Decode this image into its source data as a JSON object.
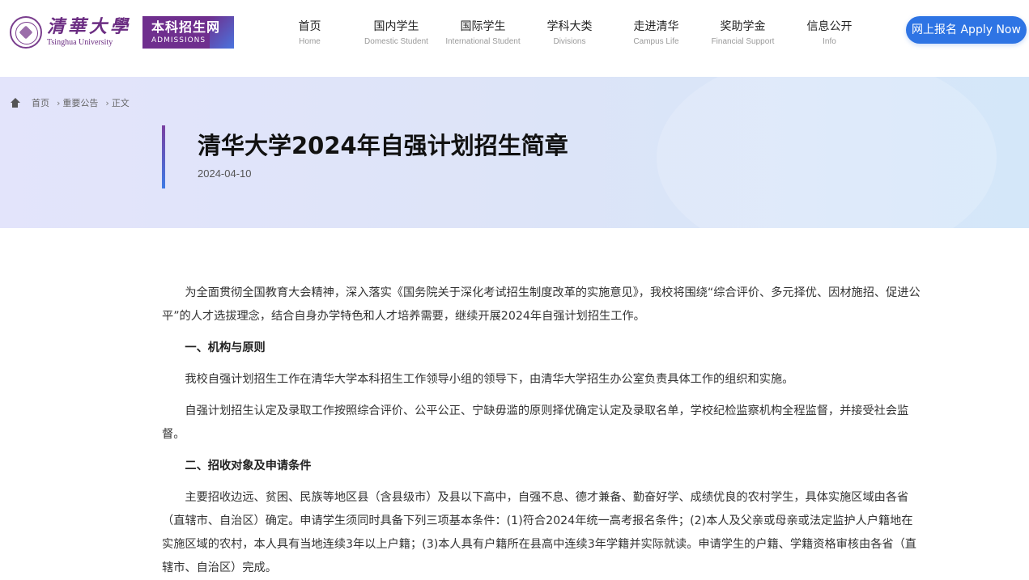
{
  "header": {
    "logo_cn": "清華大學",
    "logo_en": "Tsinghua University",
    "badge_cn": "本科招生网",
    "badge_en": "ADMISSIONS",
    "nav": [
      {
        "cn": "首页",
        "en": "Home"
      },
      {
        "cn": "国内学生",
        "en": "Domestic Student"
      },
      {
        "cn": "国际学生",
        "en": "International Student"
      },
      {
        "cn": "学科大类",
        "en": "Divisions"
      },
      {
        "cn": "走进清华",
        "en": "Campus Life"
      },
      {
        "cn": "奖助学金",
        "en": "Financial Support"
      },
      {
        "cn": "信息公开",
        "en": "Info"
      }
    ],
    "apply_label": "网上报名 Apply Now"
  },
  "breadcrumb": {
    "home": "首页",
    "items": [
      "重要公告",
      "正文"
    ],
    "separator": "›"
  },
  "article": {
    "title": "清华大学2024年自强计划招生简章",
    "date": "2024-04-10",
    "blocks": [
      {
        "type": "para",
        "text": "为全面贯彻全国教育大会精神，深入落实《国务院关于深化考试招生制度改革的实施意见》，我校将围绕“综合评价、多元择优、因材施招、促进公平”的人才选拔理念，结合自身办学特色和人才培养需要，继续开展2024年自强计划招生工作。"
      },
      {
        "type": "heading",
        "text": "一、机构与原则"
      },
      {
        "type": "para",
        "text": "我校自强计划招生工作在清华大学本科招生工作领导小组的领导下，由清华大学招生办公室负责具体工作的组织和实施。"
      },
      {
        "type": "para",
        "text": "自强计划招生认定及录取工作按照综合评价、公平公正、宁缺毋滥的原则择优确定认定及录取名单，学校纪检监察机构全程监督，并接受社会监督。"
      },
      {
        "type": "heading",
        "text": "二、招收对象及申请条件"
      },
      {
        "type": "para",
        "text": "主要招收边远、贫困、民族等地区县（含县级市）及县以下高中，自强不息、德才兼备、勤奋好学、成绩优良的农村学生，具体实施区域由各省（直辖市、自治区）确定。申请学生须同时具备下列三项基本条件：(1)符合2024年统一高考报名条件；(2)本人及父亲或母亲或法定监护人户籍地在实施区域的农村，本人具有当地连续3年以上户籍；(3)本人具有户籍所在县高中连续3年学籍并实际就读。申请学生的户籍、学籍资格审核由各省（直辖市、自治区）完成。"
      }
    ]
  },
  "colors": {
    "brand_purple": "#6f2f8e",
    "accent_blue": "#2e74e4"
  }
}
